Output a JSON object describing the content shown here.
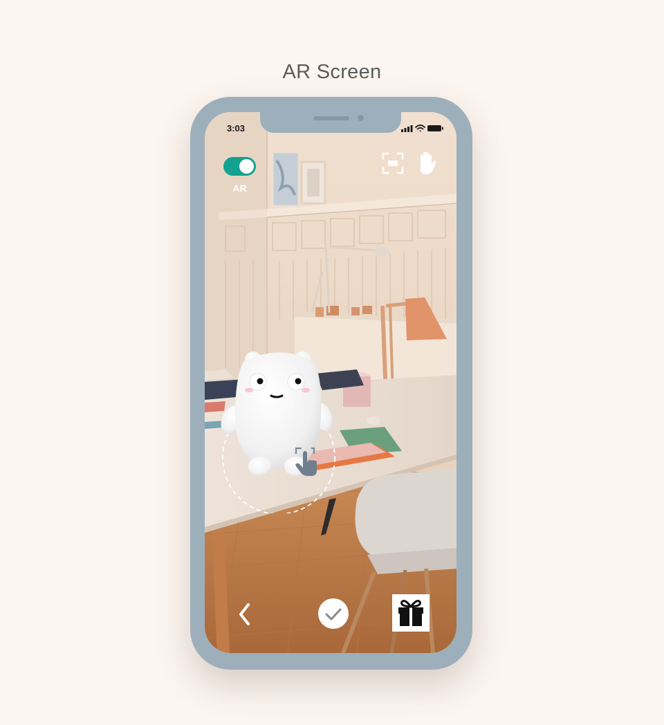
{
  "page": {
    "title": "AR Screen"
  },
  "status_bar": {
    "time": "3:03"
  },
  "ar_toggle": {
    "label": "AR",
    "state": "on",
    "color": "#13a290"
  },
  "toolbar": {
    "icons": [
      "scan-frame-icon",
      "hand-icon"
    ]
  },
  "bottom_bar": {
    "icons": [
      "chevron-left-icon",
      "check-icon",
      "gift-icon"
    ]
  },
  "colors": {
    "background": "#fdf5ef",
    "phone_frame": "#9eafbc",
    "title_text": "#5b5b5b"
  }
}
